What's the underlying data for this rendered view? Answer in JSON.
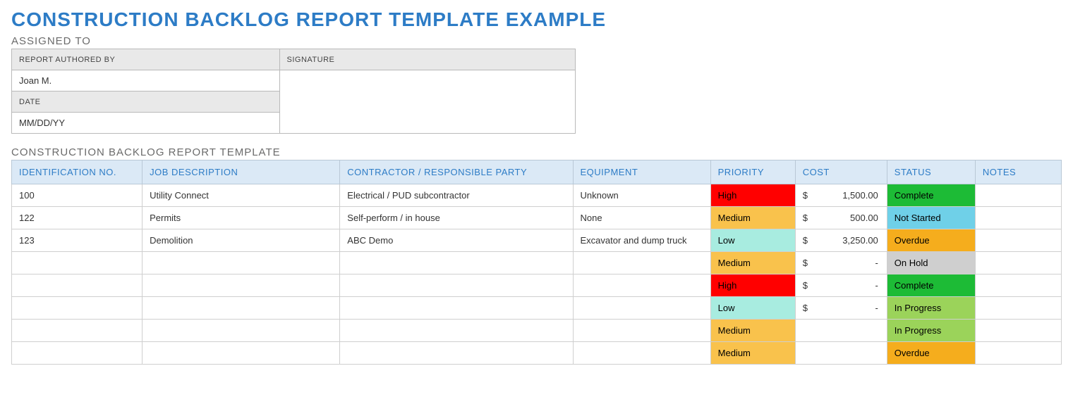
{
  "title": "CONSTRUCTION BACKLOG REPORT TEMPLATE EXAMPLE",
  "assigned": {
    "section_label": "ASSIGNED TO",
    "author_label": "REPORT AUTHORED BY",
    "signature_label": "SIGNATURE",
    "author_value": "Joan M.",
    "date_label": "DATE",
    "date_value": "MM/DD/YY",
    "signature_value": ""
  },
  "backlog": {
    "section_label": "CONSTRUCTION BACKLOG REPORT TEMPLATE",
    "headers": {
      "id": "IDENTIFICATION NO.",
      "job": "JOB DESCRIPTION",
      "contractor": "CONTRACTOR / RESPONSIBLE PARTY",
      "equipment": "EQUIPMENT",
      "priority": "PRIORITY",
      "cost": "COST",
      "status": "STATUS",
      "notes": "NOTES"
    },
    "currency_symbol": "$",
    "empty_amount": "-",
    "rows": [
      {
        "id": "100",
        "job": "Utility Connect",
        "contractor": "Electrical / PUD subcontractor",
        "equipment": "Unknown",
        "priority": "High",
        "cost": "1,500.00",
        "status": "Complete",
        "notes": ""
      },
      {
        "id": "122",
        "job": "Permits",
        "contractor": "Self-perform / in house",
        "equipment": "None",
        "priority": "Medium",
        "cost": "500.00",
        "status": "Not Started",
        "notes": ""
      },
      {
        "id": "123",
        "job": "Demolition",
        "contractor": "ABC Demo",
        "equipment": "Excavator and dump truck",
        "priority": "Low",
        "cost": "3,250.00",
        "status": "Overdue",
        "notes": ""
      },
      {
        "id": "",
        "job": "",
        "contractor": "",
        "equipment": "",
        "priority": "Medium",
        "cost": "",
        "status": "On Hold",
        "notes": ""
      },
      {
        "id": "",
        "job": "",
        "contractor": "",
        "equipment": "",
        "priority": "High",
        "cost": "",
        "status": "Complete",
        "notes": ""
      },
      {
        "id": "",
        "job": "",
        "contractor": "",
        "equipment": "",
        "priority": "Low",
        "cost": "",
        "status": "In Progress",
        "notes": ""
      },
      {
        "id": "",
        "job": "",
        "contractor": "",
        "equipment": "",
        "priority": "Medium",
        "cost": "",
        "status": "In Progress",
        "notes": ""
      },
      {
        "id": "",
        "job": "",
        "contractor": "",
        "equipment": "",
        "priority": "Medium",
        "cost": "",
        "status": "Overdue",
        "notes": ""
      }
    ]
  },
  "colors": {
    "accent": "#2d7cc6",
    "header_bg": "#dbe9f6",
    "priority": {
      "High": "#ff0000",
      "Medium": "#f9c24c",
      "Low": "#a8ece0"
    },
    "status": {
      "Complete": "#1dbb36",
      "Not Started": "#6fd0e8",
      "Overdue": "#f5ad1d",
      "On Hold": "#cfcfcf",
      "In Progress": "#9bd35a"
    }
  }
}
